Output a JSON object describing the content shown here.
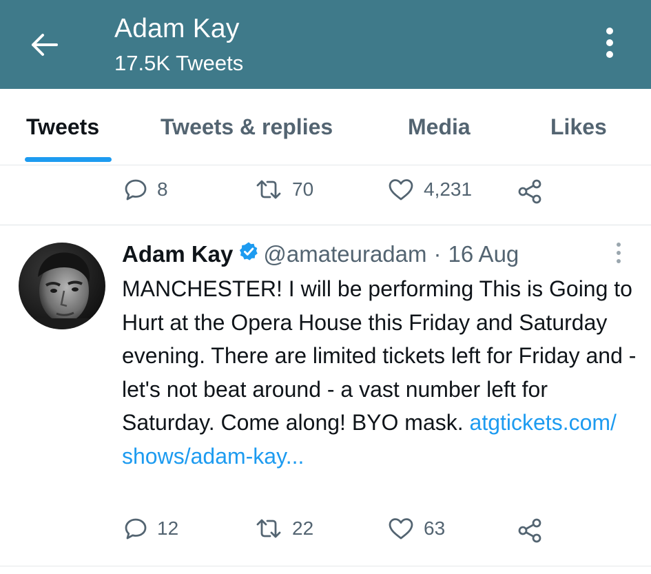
{
  "header": {
    "title": "Adam Kay",
    "subtitle": "17.5K Tweets",
    "back_icon": "arrow-left-icon",
    "more_icon": "vertical-ellipsis-icon",
    "bg_color": "#3f7a8a"
  },
  "tabs": [
    {
      "label": "Tweets",
      "active": true
    },
    {
      "label": "Tweets & replies",
      "active": false
    },
    {
      "label": "Media",
      "active": false
    },
    {
      "label": "Likes",
      "active": false
    }
  ],
  "accent_color": "#1d9bf0",
  "prev_tweet": {
    "replies": "8",
    "retweets": "70",
    "likes": "4,231"
  },
  "tweet": {
    "name": "Adam Kay",
    "handle": "@amateuradam",
    "separator": "·",
    "date": "16 Aug",
    "text": "MANCHESTER! I will be performing This is Going to Hurt at the Opera House this Friday and Saturday evening. There are limited tickets left for Friday and - let's not beat around - a vast number left for Saturday. Come along! BYO mask. ",
    "link": "atgtickets.com/​shows/adam-kay...",
    "replies": "12",
    "retweets": "22",
    "likes": "63"
  }
}
